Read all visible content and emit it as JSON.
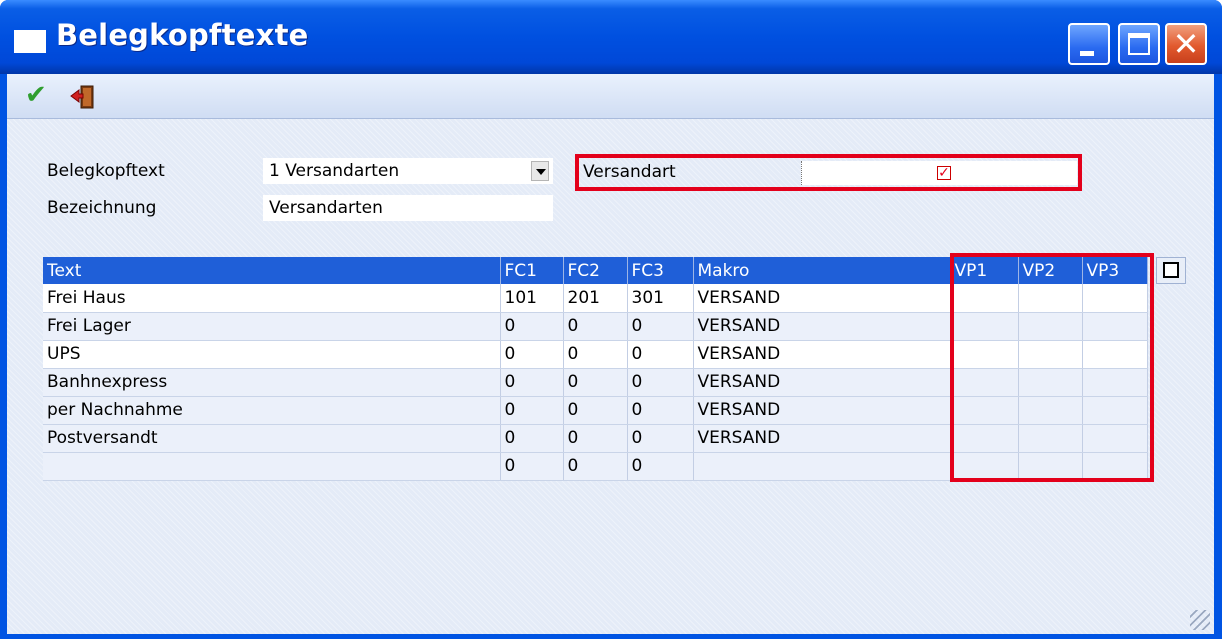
{
  "window": {
    "title": "Belegkopftexte",
    "icon": "window-icon",
    "controls": {
      "minimize": "minimize-icon",
      "maximize": "maximize-icon",
      "close": "✕"
    }
  },
  "toolbar": {
    "ok_icon": "checkmark-icon",
    "exit_icon": "exit-door-icon",
    "ok_glyph": "✔"
  },
  "form": {
    "belegkopftext_label": "Belegkopftext",
    "belegkopftext_value": "1 Versandarten",
    "bezeichnung_label": "Bezeichnung",
    "bezeichnung_value": "Versandarten",
    "versandart_label": "Versandart",
    "versandart_checked": true,
    "check_glyph": "✓"
  },
  "grid": {
    "columns": [
      "Text",
      "FC1",
      "FC2",
      "FC3",
      "Makro",
      "VP1",
      "VP2",
      "VP3"
    ],
    "rows": [
      [
        "Frei Haus",
        "101",
        "201",
        "301",
        "VERSAND",
        "",
        "",
        ""
      ],
      [
        "Frei Lager",
        "0",
        "0",
        "0",
        "VERSAND",
        "",
        "",
        ""
      ],
      [
        "UPS",
        "0",
        "0",
        "0",
        "VERSAND",
        "",
        "",
        ""
      ],
      [
        "Banhnexpress",
        "0",
        "0",
        "0",
        "VERSAND",
        "",
        "",
        ""
      ],
      [
        "per Nachnahme",
        "0",
        "0",
        "0",
        "VERSAND",
        "",
        "",
        ""
      ],
      [
        "Postversandt",
        "0",
        "0",
        "0",
        "VERSAND",
        "",
        "",
        ""
      ],
      [
        "",
        "0",
        "0",
        "0",
        "",
        "",
        "",
        ""
      ]
    ]
  },
  "colors": {
    "title_bar": "#0054e3",
    "highlight": "#e3001b",
    "grid_header": "#1f5fd8"
  }
}
